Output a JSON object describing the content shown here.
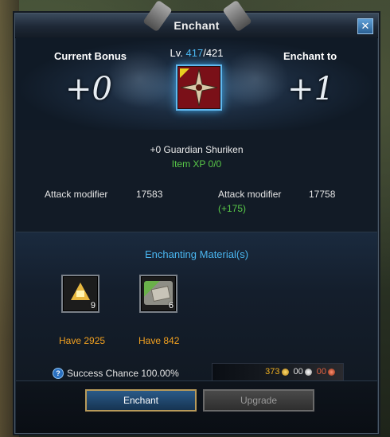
{
  "window": {
    "title": "Enchant"
  },
  "header": {
    "current_bonus_label": "Current Bonus",
    "current_bonus_value": "+0",
    "enchant_to_label": "Enchant to",
    "enchant_to_value": "+1",
    "level_prefix": "Lv.",
    "level_current": "417",
    "level_max": "/421"
  },
  "item": {
    "name": "+0 Guardian Shuriken",
    "xp": "Item XP 0/0",
    "icon": "shuriken-icon"
  },
  "stats": {
    "current_label": "Attack modifier",
    "current_value": "17583",
    "next_label": "Attack modifier",
    "next_value": "17758",
    "delta": "(+175)"
  },
  "materials": {
    "title": "Enchanting Material(s)",
    "items": [
      {
        "icon": "crystal-icon",
        "count": "9",
        "have": "Have 2925"
      },
      {
        "icon": "material-box-icon",
        "count": "6",
        "have": "Have 842"
      }
    ]
  },
  "success": {
    "icon": "help-icon",
    "text": "Success Chance 100.00%"
  },
  "currency": {
    "gold": "373",
    "silver": "00",
    "copper": "00"
  },
  "buttons": {
    "enchant": "Enchant",
    "upgrade": "Upgrade"
  },
  "colors": {
    "accent_blue": "#4ab6f0",
    "green": "#58c848",
    "orange": "#f0a020"
  }
}
